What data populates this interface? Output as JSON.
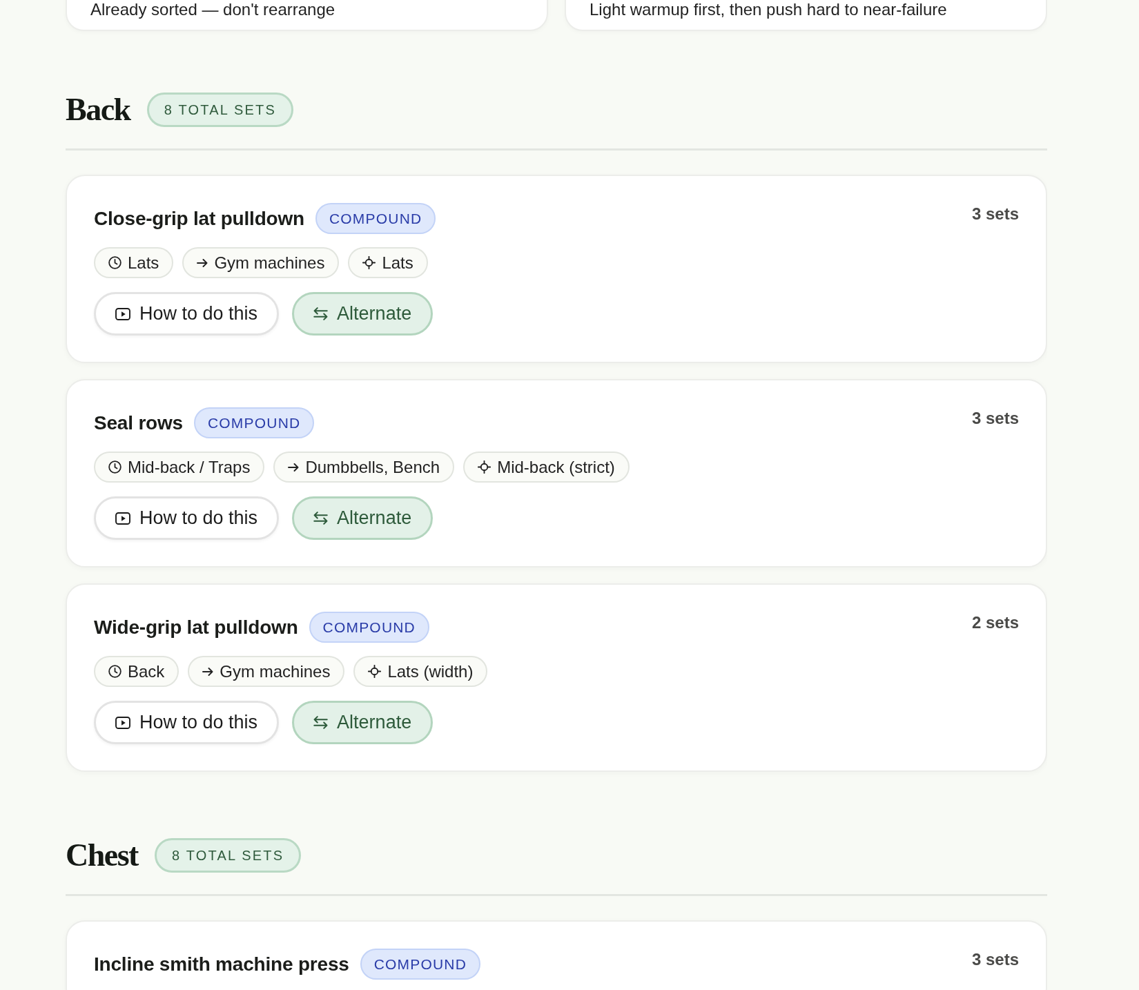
{
  "notes": [
    {
      "text": "Already sorted — don't rearrange"
    },
    {
      "text": "Light warmup first, then push hard to near-failure"
    }
  ],
  "sections": [
    {
      "title": "Back",
      "total_sets": "8 TOTAL SETS",
      "exercises": [
        {
          "name": "Close-grip lat pulldown",
          "type": "COMPOUND",
          "sets": "3 sets",
          "tags": [
            {
              "kind": "muscle",
              "text": "Lats"
            },
            {
              "kind": "equipment",
              "text": "Gym machines"
            },
            {
              "kind": "focus",
              "text": "Lats"
            }
          ],
          "buttons": [
            {
              "kind": "video",
              "label": "How to do this"
            },
            {
              "kind": "alternate",
              "label": "Alternate"
            }
          ]
        },
        {
          "name": "Seal rows",
          "type": "COMPOUND",
          "sets": "3 sets",
          "tags": [
            {
              "kind": "muscle",
              "text": "Mid-back / Traps"
            },
            {
              "kind": "equipment",
              "text": "Dumbbells, Bench"
            },
            {
              "kind": "focus",
              "text": "Mid-back (strict)"
            }
          ],
          "buttons": [
            {
              "kind": "video",
              "label": "How to do this"
            },
            {
              "kind": "alternate",
              "label": "Alternate"
            }
          ]
        },
        {
          "name": "Wide-grip lat pulldown",
          "type": "COMPOUND",
          "sets": "2 sets",
          "tags": [
            {
              "kind": "muscle",
              "text": "Back"
            },
            {
              "kind": "equipment",
              "text": "Gym machines"
            },
            {
              "kind": "focus",
              "text": "Lats (width)"
            }
          ],
          "buttons": [
            {
              "kind": "video",
              "label": "How to do this"
            },
            {
              "kind": "alternate",
              "label": "Alternate"
            }
          ]
        }
      ]
    },
    {
      "title": "Chest",
      "total_sets": "8 TOTAL SETS",
      "exercises": [
        {
          "name": "Incline smith machine press",
          "type": "COMPOUND",
          "sets": "3 sets"
        }
      ]
    }
  ]
}
